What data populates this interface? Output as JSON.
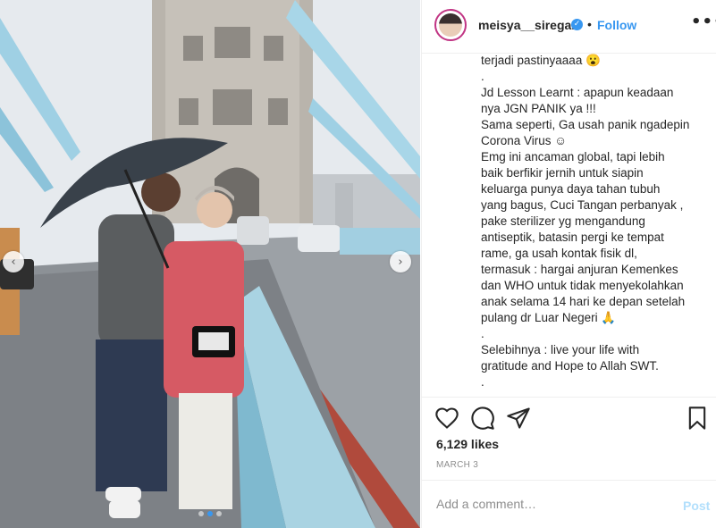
{
  "post": {
    "username": "meisya__siregar",
    "verified_icon": "verified-badge-icon",
    "separator": "•",
    "follow_label": "Follow",
    "more_label": "•••"
  },
  "photo": {
    "prev_label": "‹",
    "next_label": "›",
    "slide_count": 3,
    "active_slide": 2
  },
  "caption": {
    "lines": [
      "terjadi pastinyaaaa 😮",
      ".",
      "Jd Lesson Learnt : apapun keadaan",
      "nya JGN PANIK ya !!!",
      "Sama seperti, Ga usah panik ngadepin",
      "Corona Virus ☺",
      "Emg ini ancaman global, tapi lebih",
      "baik berfikir jernih untuk siapin",
      "keluarga punya daya tahan tubuh",
      "yang bagus, Cuci Tangan perbanyak ,",
      "pake sterilizer yg mengandung",
      "antiseptik, batasin pergi ke tempat",
      "rame, ga usah kontak fisik dl,",
      "termasuk : hargai anjuran Kemenkes",
      "dan WHO untuk tidak menyekolahkan",
      "anak selama 14 hari ke depan setelah",
      "pulang dr Luar Negeri 🙏",
      ".",
      "Selebihnya : live your life with",
      "gratitude and Hope to Allah SWT.",
      "."
    ]
  },
  "engagement": {
    "likes": "6,129 likes",
    "date": "MARCH 3"
  },
  "comment": {
    "placeholder": "Add a comment…",
    "post_label": "Post"
  },
  "colors": {
    "accent": "#3897f0",
    "post_disabled": "#b2dffc",
    "text": "#262626",
    "muted": "#8e8e8e"
  }
}
